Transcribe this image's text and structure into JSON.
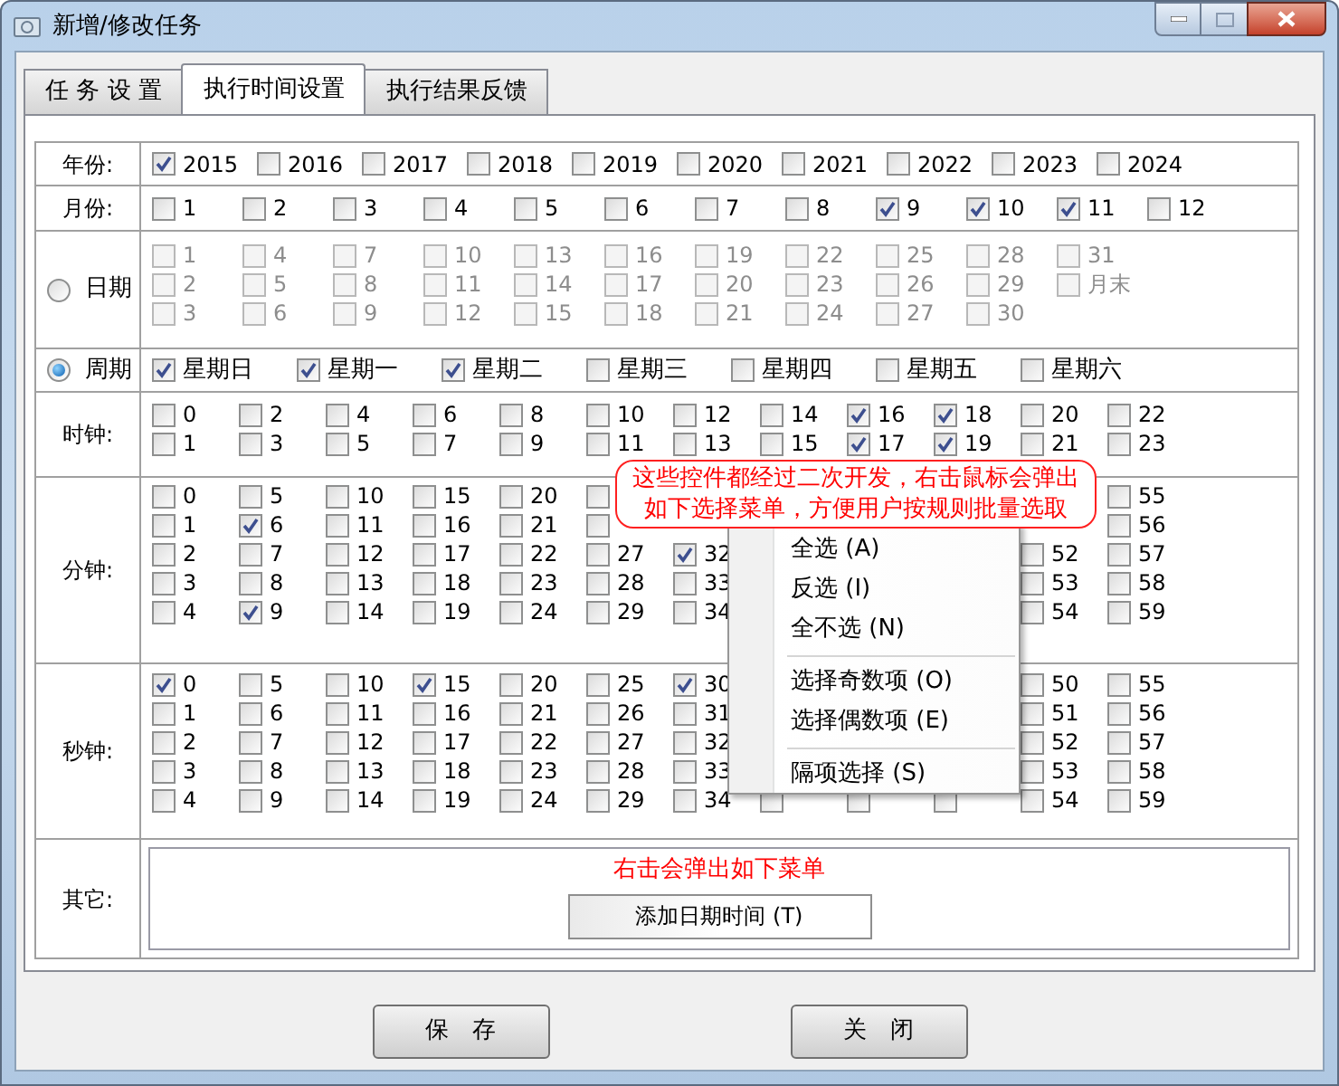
{
  "window": {
    "title": "新增/修改任务"
  },
  "tabs": [
    {
      "label": "任 务 设 置",
      "selected": false
    },
    {
      "label": "执行时间设置",
      "selected": true
    },
    {
      "label": "执行结果反馈",
      "selected": false
    }
  ],
  "years": {
    "label": "年份:",
    "items": [
      {
        "kind": "checkbox",
        "label": "2015",
        "checked": true
      },
      {
        "kind": "checkbox",
        "label": "2016",
        "checked": false
      },
      {
        "kind": "checkbox",
        "label": "2017",
        "checked": false
      },
      {
        "kind": "checkbox",
        "label": "2018",
        "checked": false
      },
      {
        "kind": "checkbox",
        "label": "2019",
        "checked": false
      },
      {
        "kind": "checkbox",
        "label": "2020",
        "checked": false
      },
      {
        "kind": "checkbox",
        "label": "2021",
        "checked": false
      },
      {
        "kind": "checkbox",
        "label": "2022",
        "checked": false
      },
      {
        "kind": "checkbox",
        "label": "2023",
        "checked": false
      },
      {
        "kind": "checkbox",
        "label": "2024",
        "checked": false
      }
    ]
  },
  "months": {
    "label": "月份:",
    "items": [
      {
        "kind": "checkbox",
        "label": "1",
        "checked": false
      },
      {
        "kind": "checkbox",
        "label": "2",
        "checked": false
      },
      {
        "kind": "checkbox",
        "label": "3",
        "checked": false
      },
      {
        "kind": "checkbox",
        "label": "4",
        "checked": false
      },
      {
        "kind": "checkbox",
        "label": "5",
        "checked": false
      },
      {
        "kind": "checkbox",
        "label": "6",
        "checked": false
      },
      {
        "kind": "checkbox",
        "label": "7",
        "checked": false
      },
      {
        "kind": "checkbox",
        "label": "8",
        "checked": false
      },
      {
        "kind": "checkbox",
        "label": "9",
        "checked": true
      },
      {
        "kind": "checkbox",
        "label": "10",
        "checked": true
      },
      {
        "kind": "checkbox",
        "label": "11",
        "checked": true
      },
      {
        "kind": "checkbox",
        "label": "12",
        "checked": false
      }
    ]
  },
  "date": {
    "label": "日期",
    "selected": false,
    "items": [
      {
        "kind": "checkbox",
        "label": "1",
        "checked": false
      },
      {
        "kind": "checkbox",
        "label": "2",
        "checked": false
      },
      {
        "kind": "checkbox",
        "label": "3",
        "checked": false
      },
      {
        "kind": "checkbox",
        "label": "4",
        "checked": false
      },
      {
        "kind": "checkbox",
        "label": "5",
        "checked": false
      },
      {
        "kind": "checkbox",
        "label": "6",
        "checked": false
      },
      {
        "kind": "checkbox",
        "label": "7",
        "checked": false
      },
      {
        "kind": "checkbox",
        "label": "8",
        "checked": false
      },
      {
        "kind": "checkbox",
        "label": "9",
        "checked": false
      },
      {
        "kind": "checkbox",
        "label": "10",
        "checked": false
      },
      {
        "kind": "checkbox",
        "label": "11",
        "checked": false
      },
      {
        "kind": "checkbox",
        "label": "12",
        "checked": false
      },
      {
        "kind": "checkbox",
        "label": "13",
        "checked": false
      },
      {
        "kind": "checkbox",
        "label": "14",
        "checked": false
      },
      {
        "kind": "checkbox",
        "label": "15",
        "checked": false
      },
      {
        "kind": "checkbox",
        "label": "16",
        "checked": false
      },
      {
        "kind": "checkbox",
        "label": "17",
        "checked": false
      },
      {
        "kind": "checkbox",
        "label": "18",
        "checked": false
      },
      {
        "kind": "checkbox",
        "label": "19",
        "checked": false
      },
      {
        "kind": "checkbox",
        "label": "20",
        "checked": false
      },
      {
        "kind": "checkbox",
        "label": "21",
        "checked": false
      },
      {
        "kind": "checkbox",
        "label": "22",
        "checked": false
      },
      {
        "kind": "checkbox",
        "label": "23",
        "checked": false
      },
      {
        "kind": "checkbox",
        "label": "24",
        "checked": false
      },
      {
        "kind": "checkbox",
        "label": "25",
        "checked": false
      },
      {
        "kind": "checkbox",
        "label": "26",
        "checked": false
      },
      {
        "kind": "checkbox",
        "label": "27",
        "checked": false
      },
      {
        "kind": "checkbox",
        "label": "28",
        "checked": false
      },
      {
        "kind": "checkbox",
        "label": "29",
        "checked": false
      },
      {
        "kind": "checkbox",
        "label": "30",
        "checked": false
      },
      {
        "kind": "checkbox",
        "label": "31",
        "checked": false
      },
      {
        "kind": "checkbox",
        "label": "月末",
        "checked": false
      }
    ]
  },
  "week": {
    "label": "周期",
    "selected": true,
    "items": [
      {
        "kind": "checkbox",
        "label": "星期日",
        "checked": true
      },
      {
        "kind": "checkbox",
        "label": "星期一",
        "checked": true
      },
      {
        "kind": "checkbox",
        "label": "星期二",
        "checked": true
      },
      {
        "kind": "checkbox",
        "label": "星期三",
        "checked": false
      },
      {
        "kind": "checkbox",
        "label": "星期四",
        "checked": false
      },
      {
        "kind": "checkbox",
        "label": "星期五",
        "checked": false
      },
      {
        "kind": "checkbox",
        "label": "星期六",
        "checked": false
      }
    ]
  },
  "hours": {
    "label": "时钟:",
    "items": [
      {
        "kind": "checkbox",
        "label": "0",
        "checked": false
      },
      {
        "kind": "checkbox",
        "label": "1",
        "checked": false
      },
      {
        "kind": "checkbox",
        "label": "2",
        "checked": false
      },
      {
        "kind": "checkbox",
        "label": "3",
        "checked": false
      },
      {
        "kind": "checkbox",
        "label": "4",
        "checked": false
      },
      {
        "kind": "checkbox",
        "label": "5",
        "checked": false
      },
      {
        "kind": "checkbox",
        "label": "6",
        "checked": false
      },
      {
        "kind": "checkbox",
        "label": "7",
        "checked": false
      },
      {
        "kind": "checkbox",
        "label": "8",
        "checked": false
      },
      {
        "kind": "checkbox",
        "label": "9",
        "checked": false
      },
      {
        "kind": "checkbox",
        "label": "10",
        "checked": false
      },
      {
        "kind": "checkbox",
        "label": "11",
        "checked": false
      },
      {
        "kind": "checkbox",
        "label": "12",
        "checked": false
      },
      {
        "kind": "checkbox",
        "label": "13",
        "checked": false
      },
      {
        "kind": "checkbox",
        "label": "14",
        "checked": false
      },
      {
        "kind": "checkbox",
        "label": "15",
        "checked": false
      },
      {
        "kind": "checkbox",
        "label": "16",
        "checked": true
      },
      {
        "kind": "checkbox",
        "label": "17",
        "checked": true
      },
      {
        "kind": "checkbox",
        "label": "18",
        "checked": true
      },
      {
        "kind": "checkbox",
        "label": "19",
        "checked": true
      },
      {
        "kind": "checkbox",
        "label": "20",
        "checked": false
      },
      {
        "kind": "checkbox",
        "label": "21",
        "checked": false
      },
      {
        "kind": "checkbox",
        "label": "22",
        "checked": false
      },
      {
        "kind": "checkbox",
        "label": "23",
        "checked": false
      }
    ]
  },
  "minutes": {
    "label": "分钟:",
    "items": [
      {
        "kind": "checkbox",
        "label": "0",
        "checked": false
      },
      {
        "kind": "checkbox",
        "label": "1",
        "checked": false
      },
      {
        "kind": "checkbox",
        "label": "2",
        "checked": false
      },
      {
        "kind": "checkbox",
        "label": "3",
        "checked": false
      },
      {
        "kind": "checkbox",
        "label": "4",
        "checked": false
      },
      {
        "kind": "checkbox",
        "label": "5",
        "checked": false
      },
      {
        "kind": "checkbox",
        "label": "6",
        "checked": true
      },
      {
        "kind": "checkbox",
        "label": "7",
        "checked": false
      },
      {
        "kind": "checkbox",
        "label": "8",
        "checked": false
      },
      {
        "kind": "checkbox",
        "label": "9",
        "checked": true
      },
      {
        "kind": "checkbox",
        "label": "10",
        "checked": false
      },
      {
        "kind": "checkbox",
        "label": "11",
        "checked": false
      },
      {
        "kind": "checkbox",
        "label": "12",
        "checked": false
      },
      {
        "kind": "checkbox",
        "label": "13",
        "checked": false
      },
      {
        "kind": "checkbox",
        "label": "14",
        "checked": false
      },
      {
        "kind": "checkbox",
        "label": "15",
        "checked": false
      },
      {
        "kind": "checkbox",
        "label": "16",
        "checked": false
      },
      {
        "kind": "checkbox",
        "label": "17",
        "checked": false
      },
      {
        "kind": "checkbox",
        "label": "18",
        "checked": false
      },
      {
        "kind": "checkbox",
        "label": "19",
        "checked": false
      },
      {
        "kind": "checkbox",
        "label": "20",
        "checked": false
      },
      {
        "kind": "checkbox",
        "label": "21",
        "checked": false
      },
      {
        "kind": "checkbox",
        "label": "22",
        "checked": false
      },
      {
        "kind": "checkbox",
        "label": "23",
        "checked": false
      },
      {
        "kind": "checkbox",
        "label": "24",
        "checked": false
      },
      {
        "kind": "box",
        "checked": false
      },
      {
        "kind": "box",
        "checked": false
      },
      {
        "kind": "checkbox",
        "label": "27",
        "checked": false
      },
      {
        "kind": "checkbox",
        "label": "28",
        "checked": false
      },
      {
        "kind": "checkbox",
        "label": "29",
        "checked": false
      },
      {
        "kind": "covered"
      },
      {
        "kind": "covered"
      },
      {
        "kind": "checkbox",
        "label": "32",
        "checked": true
      },
      {
        "kind": "checkbox",
        "label": "33",
        "checked": false
      },
      {
        "kind": "checkbox",
        "label": "34",
        "checked": false
      },
      {
        "kind": "covered"
      },
      {
        "kind": "covered"
      },
      {
        "kind": "covered"
      },
      {
        "kind": "covered"
      },
      {
        "kind": "covered"
      },
      {
        "kind": "covered"
      },
      {
        "kind": "covered"
      },
      {
        "kind": "covered"
      },
      {
        "kind": "covered"
      },
      {
        "kind": "covered"
      },
      {
        "kind": "covered"
      },
      {
        "kind": "covered"
      },
      {
        "kind": "covered"
      },
      {
        "kind": "covered"
      },
      {
        "kind": "covered"
      },
      {
        "kind": "covered"
      },
      {
        "kind": "covered"
      },
      {
        "kind": "checkbox",
        "label": "52",
        "checked": false
      },
      {
        "kind": "checkbox",
        "label": "53",
        "checked": false
      },
      {
        "kind": "checkbox",
        "label": "54",
        "checked": false
      },
      {
        "kind": "checkbox",
        "label": "55",
        "checked": false
      },
      {
        "kind": "checkbox",
        "label": "56",
        "checked": false
      },
      {
        "kind": "checkbox",
        "label": "57",
        "checked": false
      },
      {
        "kind": "checkbox",
        "label": "58",
        "checked": false
      },
      {
        "kind": "checkbox",
        "label": "59",
        "checked": false
      }
    ]
  },
  "seconds": {
    "label": "秒钟:",
    "items": [
      {
        "kind": "checkbox",
        "label": "0",
        "checked": true
      },
      {
        "kind": "checkbox",
        "label": "1",
        "checked": false
      },
      {
        "kind": "checkbox",
        "label": "2",
        "checked": false
      },
      {
        "kind": "checkbox",
        "label": "3",
        "checked": false
      },
      {
        "kind": "checkbox",
        "label": "4",
        "checked": false
      },
      {
        "kind": "checkbox",
        "label": "5",
        "checked": false
      },
      {
        "kind": "checkbox",
        "label": "6",
        "checked": false
      },
      {
        "kind": "checkbox",
        "label": "7",
        "checked": false
      },
      {
        "kind": "checkbox",
        "label": "8",
        "checked": false
      },
      {
        "kind": "checkbox",
        "label": "9",
        "checked": false
      },
      {
        "kind": "checkbox",
        "label": "10",
        "checked": false
      },
      {
        "kind": "checkbox",
        "label": "11",
        "checked": false
      },
      {
        "kind": "checkbox",
        "label": "12",
        "checked": false
      },
      {
        "kind": "checkbox",
        "label": "13",
        "checked": false
      },
      {
        "kind": "checkbox",
        "label": "14",
        "checked": false
      },
      {
        "kind": "checkbox",
        "label": "15",
        "checked": true
      },
      {
        "kind": "checkbox",
        "label": "16",
        "checked": false
      },
      {
        "kind": "checkbox",
        "label": "17",
        "checked": false
      },
      {
        "kind": "checkbox",
        "label": "18",
        "checked": false
      },
      {
        "kind": "checkbox",
        "label": "19",
        "checked": false
      },
      {
        "kind": "checkbox",
        "label": "20",
        "checked": false
      },
      {
        "kind": "checkbox",
        "label": "21",
        "checked": false
      },
      {
        "kind": "checkbox",
        "label": "22",
        "checked": false
      },
      {
        "kind": "checkbox",
        "label": "23",
        "checked": false
      },
      {
        "kind": "checkbox",
        "label": "24",
        "checked": false
      },
      {
        "kind": "checkbox",
        "label": "25",
        "checked": false
      },
      {
        "kind": "checkbox",
        "label": "26",
        "checked": false
      },
      {
        "kind": "checkbox",
        "label": "27",
        "checked": false
      },
      {
        "kind": "checkbox",
        "label": "28",
        "checked": false
      },
      {
        "kind": "checkbox",
        "label": "29",
        "checked": false
      },
      {
        "kind": "checkbox",
        "label": "30",
        "checked": true
      },
      {
        "kind": "checkbox",
        "label": "31",
        "checked": false
      },
      {
        "kind": "checkbox",
        "label": "32",
        "checked": false
      },
      {
        "kind": "checkbox",
        "label": "33",
        "checked": false
      },
      {
        "kind": "checkbox",
        "label": "34",
        "checked": false
      },
      {
        "kind": "covered"
      },
      {
        "kind": "covered"
      },
      {
        "kind": "covered"
      },
      {
        "kind": "covered"
      },
      {
        "kind": "box",
        "checked": false
      },
      {
        "kind": "covered"
      },
      {
        "kind": "covered"
      },
      {
        "kind": "covered"
      },
      {
        "kind": "covered"
      },
      {
        "kind": "box",
        "checked": false
      },
      {
        "kind": "covered"
      },
      {
        "kind": "covered"
      },
      {
        "kind": "covered"
      },
      {
        "kind": "covered"
      },
      {
        "kind": "box",
        "checked": false
      },
      {
        "kind": "checkbox",
        "label": "50",
        "checked": false
      },
      {
        "kind": "checkbox",
        "label": "51",
        "checked": false
      },
      {
        "kind": "checkbox",
        "label": "52",
        "checked": false
      },
      {
        "kind": "checkbox",
        "label": "53",
        "checked": false
      },
      {
        "kind": "checkbox",
        "label": "54",
        "checked": false
      },
      {
        "kind": "checkbox",
        "label": "55",
        "checked": false
      },
      {
        "kind": "checkbox",
        "label": "56",
        "checked": false
      },
      {
        "kind": "checkbox",
        "label": "57",
        "checked": false
      },
      {
        "kind": "checkbox",
        "label": "58",
        "checked": false
      },
      {
        "kind": "checkbox",
        "label": "59",
        "checked": false
      }
    ]
  },
  "other": {
    "label": "其它:",
    "note": "右击会弹出如下菜单",
    "menu_item": "添加日期时间 (T)"
  },
  "callout": "这些控件都经过二次开发，右击鼠标会弹出如下选择菜单，方便用户按规则批量选取",
  "context_menu": [
    {
      "kind": "item",
      "label": "全选 (A)"
    },
    {
      "kind": "item",
      "label": "反选 (I)"
    },
    {
      "kind": "item",
      "label": "全不选 (N)"
    },
    {
      "kind": "separator"
    },
    {
      "kind": "item",
      "label": "选择奇数项 (O)"
    },
    {
      "kind": "item",
      "label": "选择偶数项 (E)"
    },
    {
      "kind": "separator"
    },
    {
      "kind": "item",
      "label": "隔项选择 (S)"
    }
  ],
  "buttons": [
    "保　存",
    "关　闭"
  ]
}
